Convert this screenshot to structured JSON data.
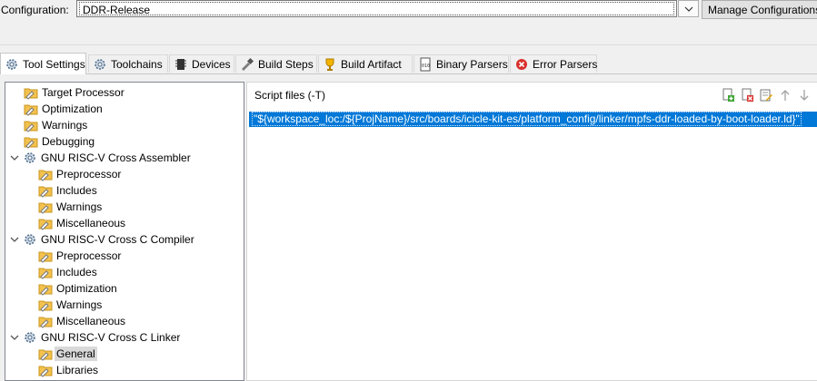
{
  "config": {
    "label": "Configuration:",
    "value": "DDR-Release",
    "manage_label": "Manage Configurations..."
  },
  "tabs": [
    {
      "label": "Tool Settings",
      "icon": "gears-icon",
      "active": true
    },
    {
      "label": "Toolchains",
      "icon": "gears-icon"
    },
    {
      "label": "Devices",
      "icon": "chip-icon"
    },
    {
      "label": "Build Steps",
      "icon": "build-steps-icon"
    },
    {
      "label": "Build Artifact",
      "icon": "trophy-icon"
    },
    {
      "label": "Binary Parsers",
      "icon": "binary-file-icon"
    },
    {
      "label": "Error Parsers",
      "icon": "error-icon"
    }
  ],
  "tree": [
    {
      "label": "Target Processor",
      "type": "folder"
    },
    {
      "label": "Optimization",
      "type": "folder"
    },
    {
      "label": "Warnings",
      "type": "folder"
    },
    {
      "label": "Debugging",
      "type": "folder"
    },
    {
      "label": "GNU RISC-V Cross Assembler",
      "type": "tool"
    },
    {
      "label": "Preprocessor",
      "type": "folder"
    },
    {
      "label": "Includes",
      "type": "folder"
    },
    {
      "label": "Warnings",
      "type": "folder"
    },
    {
      "label": "Miscellaneous",
      "type": "folder"
    },
    {
      "label": "GNU RISC-V Cross C Compiler",
      "type": "tool"
    },
    {
      "label": "Preprocessor",
      "type": "folder"
    },
    {
      "label": "Includes",
      "type": "folder"
    },
    {
      "label": "Optimization",
      "type": "folder"
    },
    {
      "label": "Warnings",
      "type": "folder"
    },
    {
      "label": "Miscellaneous",
      "type": "folder"
    },
    {
      "label": "GNU RISC-V Cross C Linker",
      "type": "tool"
    },
    {
      "label": "General",
      "type": "folder",
      "selected": true
    },
    {
      "label": "Libraries",
      "type": "folder"
    }
  ],
  "script_files": {
    "title": "Script files (-T)",
    "items": [
      "\"${workspace_loc:/${ProjName}/src/boards/icicle-kit-es/platform_config/linker/mpfs-ddr-loaded-by-boot-loader.ld}\""
    ],
    "toolbar": [
      "add-icon",
      "delete-icon",
      "edit-icon",
      "move-up-icon",
      "move-down-icon"
    ]
  },
  "colors": {
    "selection": "#0078d7",
    "tree_selected": "#d9d9d9",
    "folder": "#f3c24e"
  }
}
